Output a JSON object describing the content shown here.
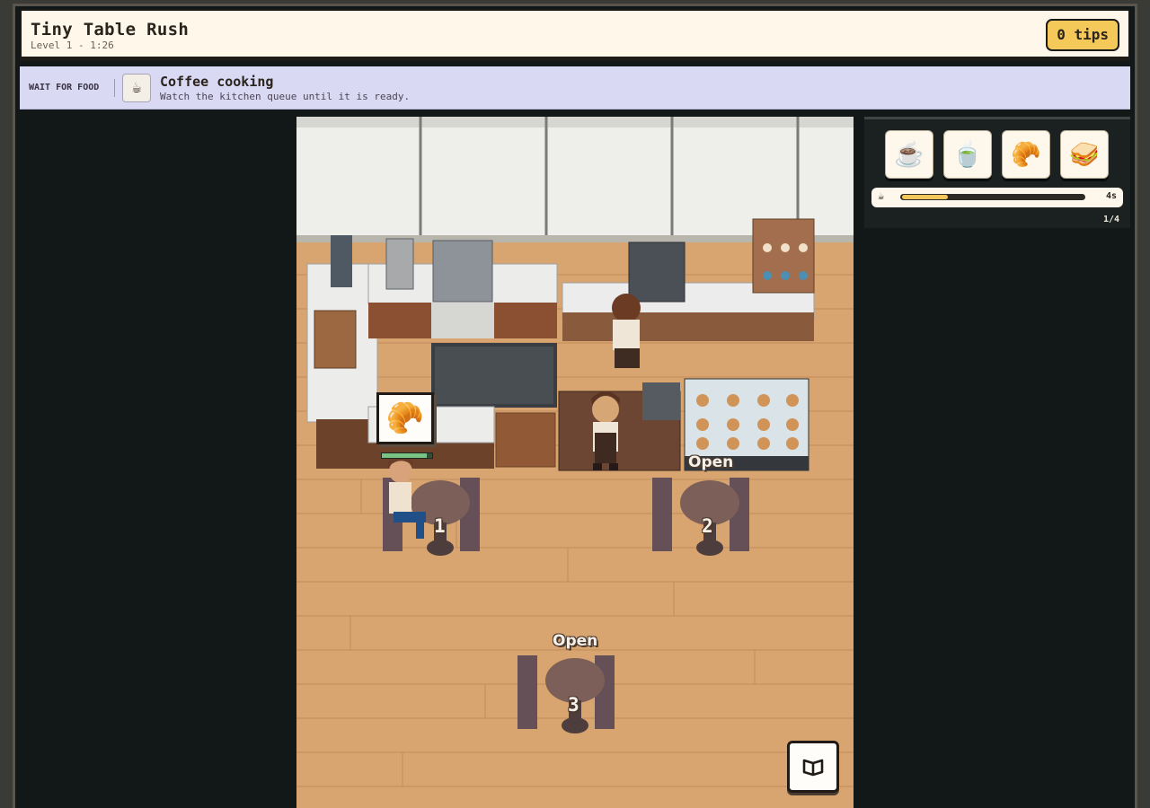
{
  "header": {
    "title": "Tiny Table Rush",
    "subtitle": "Level 1 - 1:26",
    "tips": "0 tips"
  },
  "banner": {
    "tag": "WAIT FOR FOOD",
    "icon": "☕",
    "title": "Coffee cooking",
    "text": "Watch the kitchen queue until it is ready."
  },
  "menu": [
    {
      "name": "coffee",
      "icon": "☕"
    },
    {
      "name": "tea",
      "icon": "🍵"
    },
    {
      "name": "croissant",
      "icon": "🥐"
    },
    {
      "name": "sandwich",
      "icon": "🥪"
    }
  ],
  "queue": {
    "icon": "☕",
    "progress": 0.25,
    "time": "4s",
    "count": "1/4"
  },
  "scene": {
    "order_icon": "🥐",
    "order_progress": 0.9,
    "pastry_case_status": "Open",
    "tables": [
      {
        "number": "1"
      },
      {
        "number": "2"
      },
      {
        "number": "3",
        "status": "Open"
      }
    ]
  },
  "colors": {
    "floor": "#d8a46f",
    "wall": "#eeeeea",
    "accent": "#f4c959",
    "banner": "#d9d9f3"
  }
}
